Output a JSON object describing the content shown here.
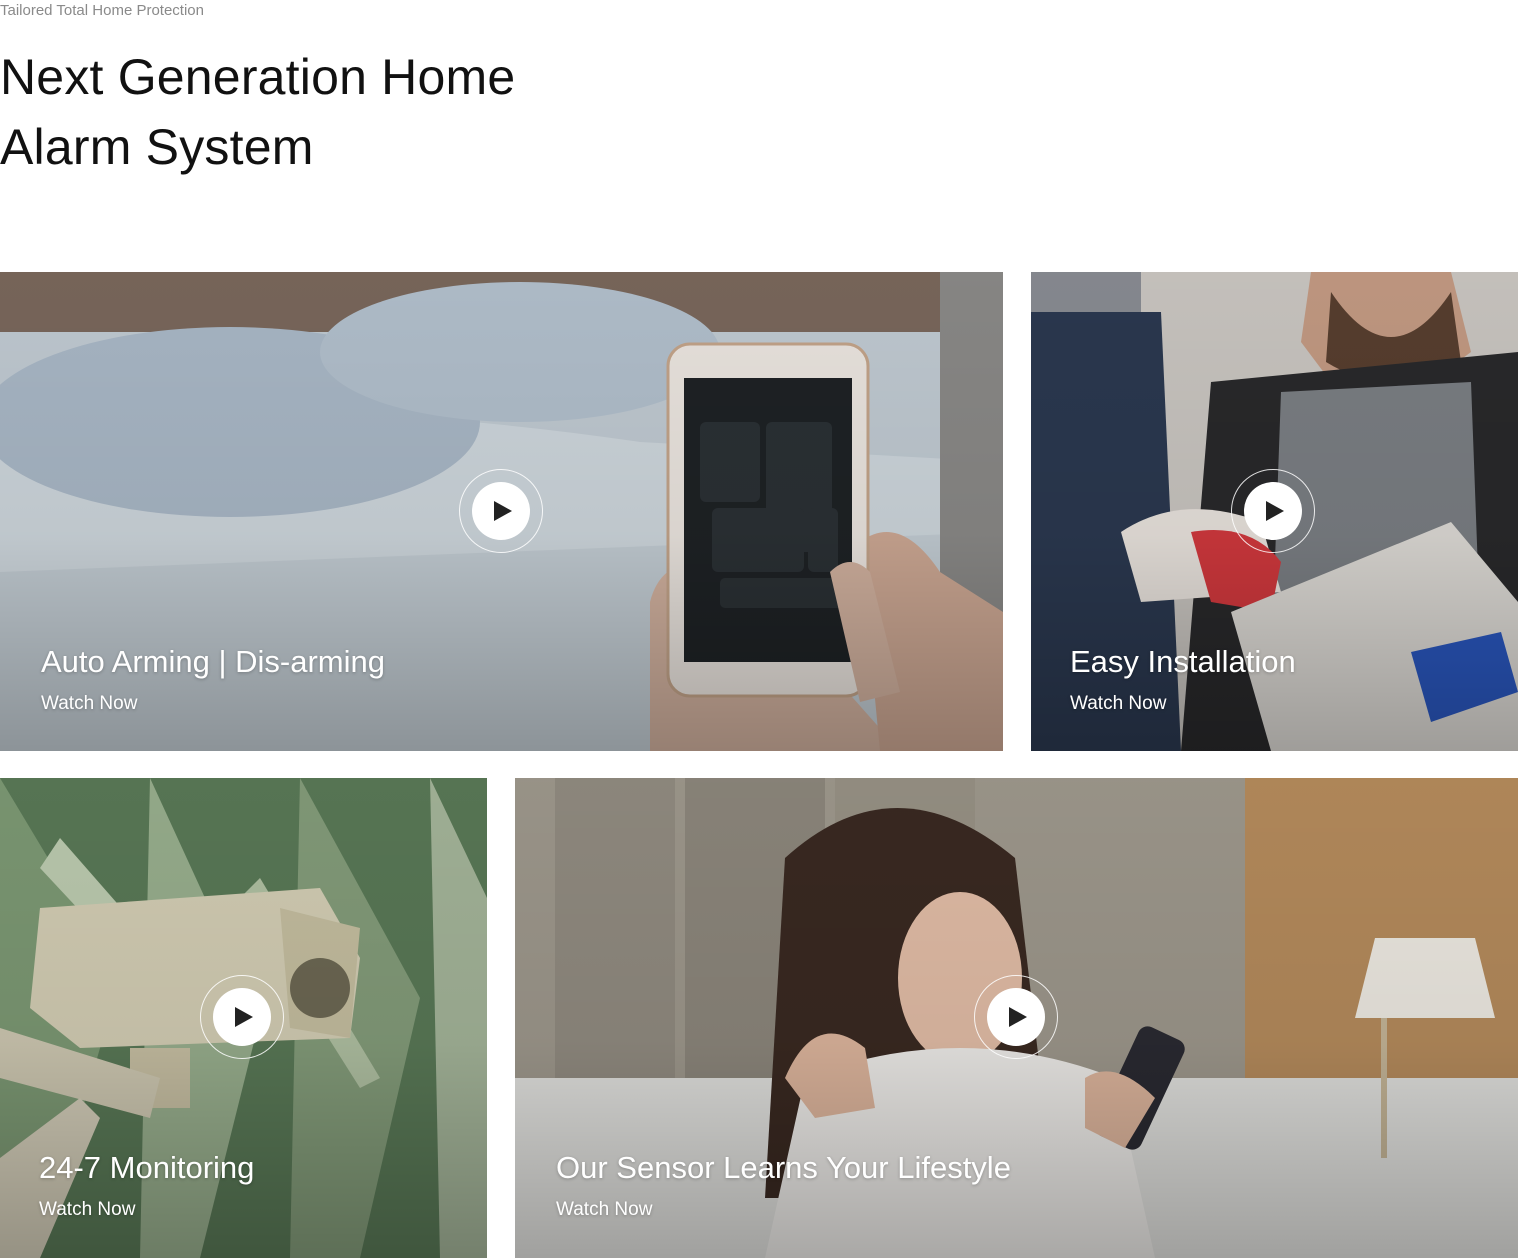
{
  "hero": {
    "eyebrow": "Tailored Total Home Protection",
    "headline": "Next Generation Home Alarm System"
  },
  "cards": [
    {
      "title": "Auto Arming | Dis-arming",
      "cta": "Watch Now",
      "icon": "play-icon"
    },
    {
      "title": "Easy Installation",
      "cta": "Watch Now",
      "icon": "play-icon"
    },
    {
      "title": "24-7 Monitoring",
      "cta": "Watch Now",
      "icon": "play-icon"
    },
    {
      "title": "Our Sensor Learns Your Lifestyle",
      "cta": "Watch Now",
      "icon": "play-icon"
    }
  ],
  "colors": {
    "background": "#ffffff",
    "eyebrow": "#8a8a8a",
    "headline": "#111111",
    "card_text": "#ffffff"
  }
}
